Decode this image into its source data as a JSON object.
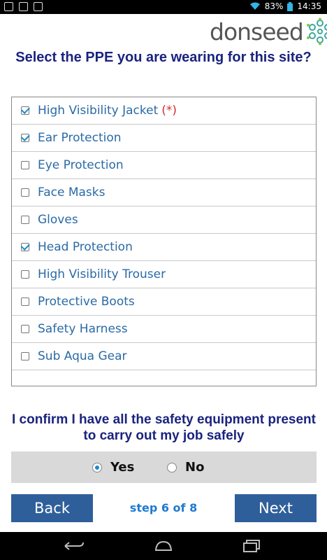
{
  "statusbar": {
    "battery": "83%",
    "time": "14:35"
  },
  "brand": {
    "name": "donseed",
    "accent": "#3aa7a0"
  },
  "question": "Select the PPE you are wearing for this site?",
  "ppe_items": [
    {
      "label": "High Visibility Jacket",
      "checked": true,
      "required": "(*)"
    },
    {
      "label": "Ear Protection",
      "checked": true
    },
    {
      "label": "Eye Protection",
      "checked": false
    },
    {
      "label": "Face Masks",
      "checked": false
    },
    {
      "label": "Gloves",
      "checked": false
    },
    {
      "label": "Head Protection",
      "checked": true
    },
    {
      "label": "High Visibility Trouser",
      "checked": false
    },
    {
      "label": "Protective Boots",
      "checked": false
    },
    {
      "label": "Safety Harness",
      "checked": false
    },
    {
      "label": "Sub Aqua Gear",
      "checked": false
    }
  ],
  "confirm": "I confirm I have all the safety equipment present to carry out my job safely",
  "confirm_options": {
    "yes": "Yes",
    "no": "No",
    "selected": "Yes"
  },
  "footer": {
    "back": "Back",
    "step": "step 6 of 8",
    "next": "Next"
  },
  "colors": {
    "heading": "#1a237e",
    "item_text": "#2a6aa6",
    "button": "#2f5f9a",
    "step": "#1e7ad2",
    "required": "#d32f2f"
  }
}
